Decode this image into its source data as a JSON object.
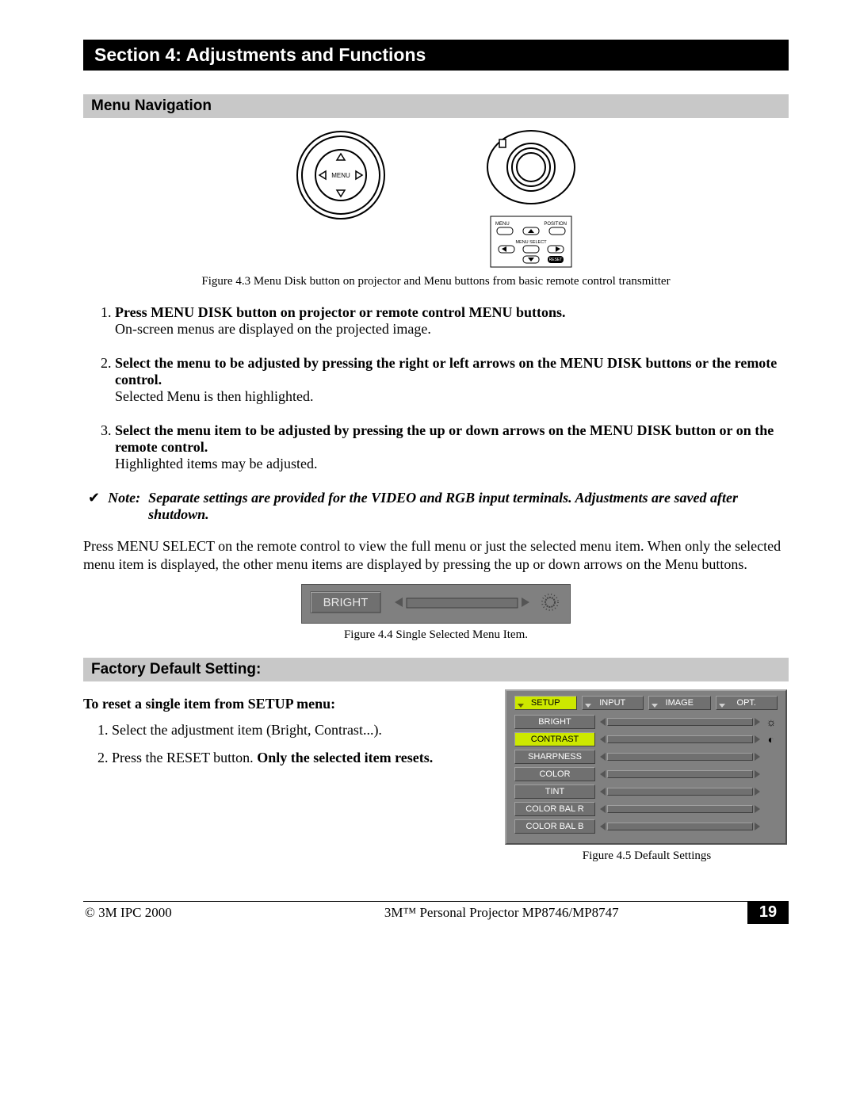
{
  "section_title": "Section 4: Adjustments and Functions",
  "sub1": "Menu Navigation",
  "menu_disk_label": "MENU",
  "remote_labels": {
    "menu": "MENU",
    "position": "POSITION",
    "menu_select": "MENU SELECT",
    "reset": "RESET"
  },
  "fig43": "Figure 4.3 Menu Disk button on projector and Menu buttons from basic remote control transmitter",
  "steps": [
    {
      "bold": "Press MENU DISK button on projector or remote control MENU buttons.",
      "plain": "On-screen menus are displayed on the projected image."
    },
    {
      "bold": "Select the menu to be adjusted by pressing the right or left arrows on the MENU DISK buttons or the remote control.",
      "plain": "Selected Menu is then highlighted."
    },
    {
      "bold": "Select the menu item to be adjusted by pressing the up or down arrows on the MENU DISK button or on the remote control.",
      "plain": "Highlighted items may be adjusted."
    }
  ],
  "note": {
    "label": "Note:",
    "text": "Separate settings are provided for the VIDEO and RGB input terminals.  Adjustments are saved after shutdown."
  },
  "para_menu_select": "Press MENU SELECT on the remote control to view the full menu or just the selected menu item. When only the selected menu item is displayed, the other menu items are displayed by pressing the up or down arrows on the Menu buttons.",
  "bright_label": "BRIGHT",
  "fig44": "Figure 4.4 Single Selected Menu Item.",
  "sub2": "Factory Default Setting:",
  "reset_head": "To reset a single item from SETUP menu:",
  "reset_steps": [
    "Select the adjustment item (Bright, Contrast...).",
    "Press the RESET button.  "
  ],
  "reset_bold_tail": "Only the selected item resets.",
  "setup_menu": {
    "tabs": [
      "SETUP",
      "INPUT",
      "IMAGE",
      "OPT."
    ],
    "selected_tab": 0,
    "items": [
      "BRIGHT",
      "CONTRAST",
      "SHARPNESS",
      "COLOR",
      "TINT",
      "COLOR BAL R",
      "COLOR BAL B"
    ],
    "selected_item": 1,
    "icons": [
      "sun",
      "contrast"
    ]
  },
  "fig45": "Figure 4.5 Default Settings",
  "footer": {
    "left": "© 3M IPC 2000",
    "mid": "3M™ Personal Projector MP8746/MP8747",
    "page": "19"
  }
}
